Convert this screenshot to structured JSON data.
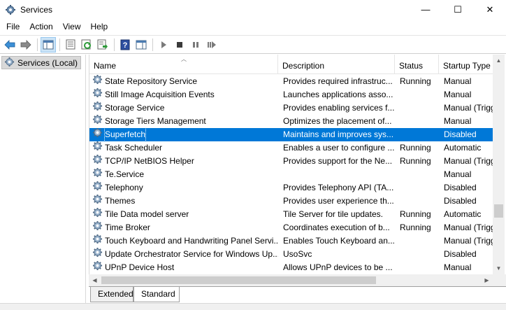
{
  "window": {
    "title": "Services",
    "minimize_glyph": "—",
    "maximize_glyph": "☐",
    "close_glyph": "✕"
  },
  "menu": [
    "File",
    "Action",
    "View",
    "Help"
  ],
  "toolbar_icons": [
    "back-arrow-icon",
    "forward-arrow-icon",
    "show-hide-console-tree-icon",
    "properties-icon",
    "refresh-icon",
    "export-list-icon",
    "help-icon",
    "show-hide-action-pane-icon",
    "start-service-icon",
    "stop-service-icon",
    "pause-service-icon",
    "restart-service-icon"
  ],
  "tree": {
    "root_label": "Services (Local)"
  },
  "columns": {
    "name": "Name",
    "description": "Description",
    "status": "Status",
    "startup_type": "Startup Type"
  },
  "services": [
    {
      "name": "State Repository Service",
      "description": "Provides required infrastruc...",
      "status": "Running",
      "startup": "Manual"
    },
    {
      "name": "Still Image Acquisition Events",
      "description": "Launches applications asso...",
      "status": "",
      "startup": "Manual"
    },
    {
      "name": "Storage Service",
      "description": "Provides enabling services f...",
      "status": "",
      "startup": "Manual (Trigg"
    },
    {
      "name": "Storage Tiers Management",
      "description": "Optimizes the placement of...",
      "status": "",
      "startup": "Manual"
    },
    {
      "name": "Superfetch",
      "description": "Maintains and improves sys...",
      "status": "",
      "startup": "Disabled",
      "selected": true
    },
    {
      "name": "Task Scheduler",
      "description": "Enables a user to configure ...",
      "status": "Running",
      "startup": "Automatic"
    },
    {
      "name": "TCP/IP NetBIOS Helper",
      "description": "Provides support for the Ne...",
      "status": "Running",
      "startup": "Manual (Trigg"
    },
    {
      "name": "Te.Service",
      "description": "",
      "status": "",
      "startup": "Manual"
    },
    {
      "name": "Telephony",
      "description": "Provides Telephony API (TA...",
      "status": "",
      "startup": "Disabled"
    },
    {
      "name": "Themes",
      "description": "Provides user experience th...",
      "status": "",
      "startup": "Disabled"
    },
    {
      "name": "Tile Data model server",
      "description": "Tile Server for tile updates.",
      "status": "Running",
      "startup": "Automatic"
    },
    {
      "name": "Time Broker",
      "description": "Coordinates execution of b...",
      "status": "Running",
      "startup": "Manual (Trigg"
    },
    {
      "name": "Touch Keyboard and Handwriting Panel Servi...",
      "description": "Enables Touch Keyboard an...",
      "status": "",
      "startup": "Manual (Trigg"
    },
    {
      "name": "Update Orchestrator Service for Windows Up...",
      "description": "UsoSvc",
      "status": "",
      "startup": "Disabled"
    },
    {
      "name": "UPnP Device Host",
      "description": "Allows UPnP devices to be ...",
      "status": "",
      "startup": "Manual"
    }
  ],
  "tabs": {
    "extended": "Extended",
    "standard": "Standard",
    "active": "Standard"
  },
  "colors": {
    "selection": "#0078d7",
    "toolbar_active": "#cce4f7"
  }
}
